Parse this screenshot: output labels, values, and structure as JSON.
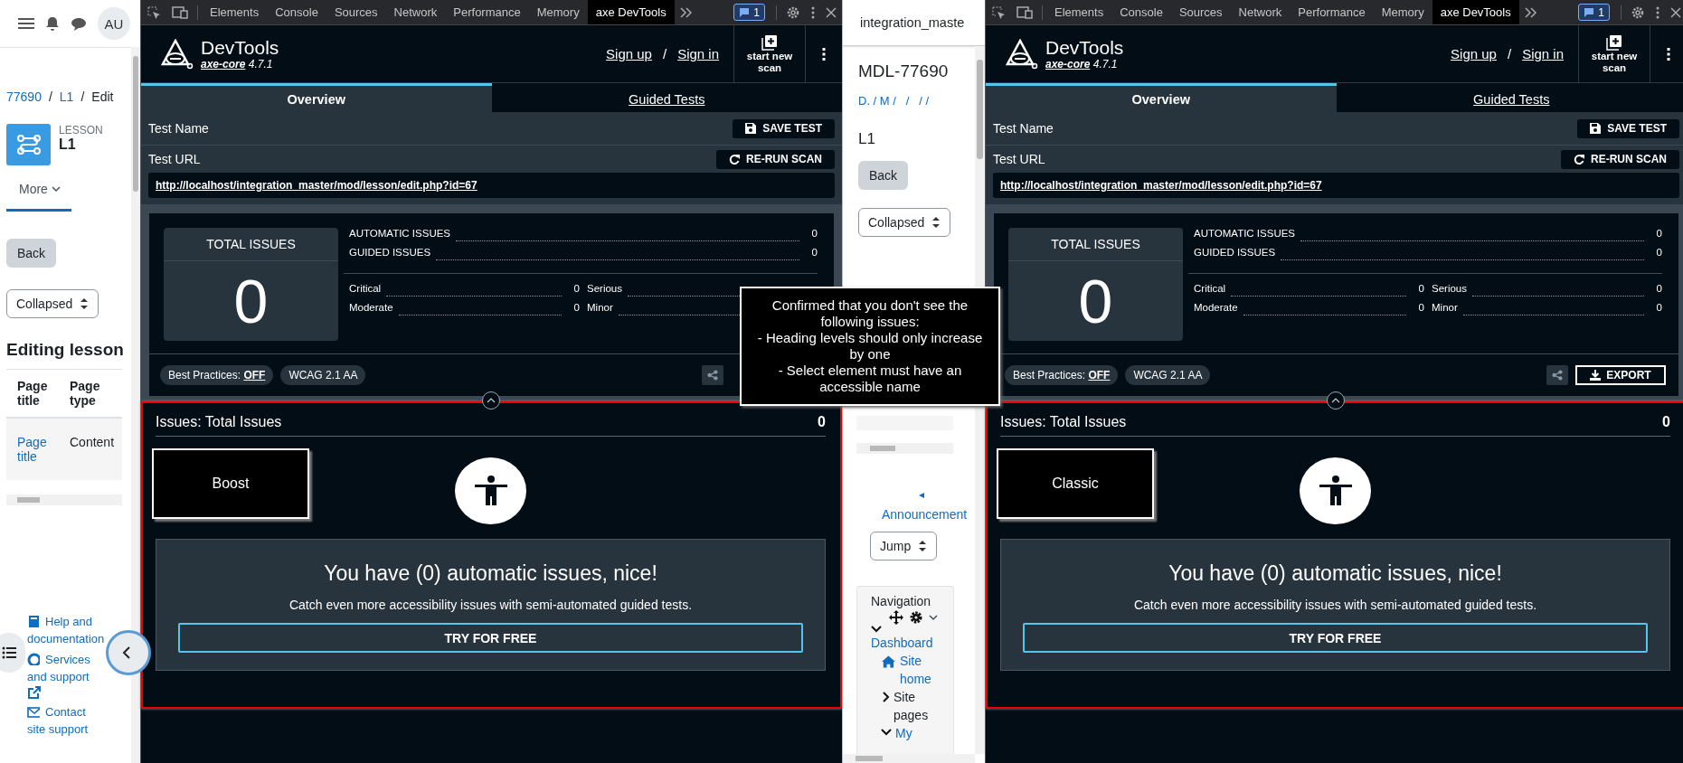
{
  "boost_page": {
    "avatar": "AU",
    "breadcrumb": [
      "77690",
      "L1",
      "Edit"
    ],
    "breadcrumb_separator": "/",
    "activity": {
      "type_label": "LESSON",
      "title": "L1"
    },
    "more": "More",
    "back_button": "Back",
    "view_select": "Collapsed",
    "heading": "Editing lesson",
    "table": {
      "columns": [
        "Page title",
        "Page type"
      ],
      "rows": [
        {
          "cells": [
            "Page title",
            "Content"
          ]
        }
      ]
    },
    "footer_links": [
      {
        "kind": "help",
        "label": "Help and documentation"
      },
      {
        "kind": "services",
        "label": "Services and support"
      },
      {
        "kind": "contact",
        "label": "Contact site support"
      }
    ]
  },
  "devtools_panes": [
    {
      "toolbar_tabs": [
        {
          "label": "Elements",
          "selected": false
        },
        {
          "label": "Console",
          "selected": false
        },
        {
          "label": "Sources",
          "selected": false
        },
        {
          "label": "Network",
          "selected": false
        },
        {
          "label": "Performance",
          "selected": false
        },
        {
          "label": "Memory",
          "selected": false
        },
        {
          "label": "axe DevTools",
          "selected": true
        }
      ],
      "message_count": "1",
      "brand": {
        "title": "DevTools",
        "engine": "axe-core",
        "version": "4.7.1"
      },
      "auth_links": [
        "Sign up",
        "Sign in"
      ],
      "auth_separator": "/",
      "new_scan": "start new scan",
      "view_tabs": [
        {
          "label": "Overview",
          "selected": true
        },
        {
          "label": "Guided Tests",
          "selected": false
        }
      ],
      "test_name_label": "Test Name",
      "save_button": "SAVE TEST",
      "test_url_label": "Test URL",
      "rerun_button": "RE-RUN SCAN",
      "url": "http://localhost/integration_master/mod/lesson/edit.php?id=67",
      "total": {
        "label": "TOTAL ISSUES",
        "value": "0"
      },
      "issue_counts": [
        {
          "label": "AUTOMATIC ISSUES",
          "value": "0"
        },
        {
          "label": "GUIDED ISSUES",
          "value": "0"
        }
      ],
      "severities": [
        {
          "label": "Critical",
          "value": "0"
        },
        {
          "label": "Serious"
        },
        {
          "label": "Moderate",
          "value": "0"
        },
        {
          "label": "Minor"
        }
      ],
      "best_practices": {
        "label": "Best Practices:",
        "value": "OFF"
      },
      "standard": "WCAG 2.1 AA",
      "issues": {
        "title": "Issues: Total Issues",
        "count": "0"
      },
      "theme_label": "Boost",
      "empty_state": {
        "heading": "You have (0) automatic issues, nice!",
        "text": "Catch even more accessibility issues with semi-automated guided tests.",
        "button": "TRY FOR FREE"
      }
    },
    {
      "toolbar_tabs": [
        {
          "label": "Elements",
          "selected": false
        },
        {
          "label": "Console",
          "selected": false
        },
        {
          "label": "Sources",
          "selected": false
        },
        {
          "label": "Network",
          "selected": false
        },
        {
          "label": "Performance",
          "selected": false
        },
        {
          "label": "Memory",
          "selected": false
        },
        {
          "label": "axe DevTools",
          "selected": true
        }
      ],
      "message_count": "1",
      "brand": {
        "title": "DevTools",
        "engine": "axe-core",
        "version": "4.7.1"
      },
      "auth_links": [
        "Sign up",
        "Sign in"
      ],
      "auth_separator": "/",
      "new_scan": "start new scan",
      "view_tabs": [
        {
          "label": "Overview",
          "selected": true
        },
        {
          "label": "Guided Tests",
          "selected": false
        }
      ],
      "test_name_label": "Test Name",
      "save_button": "SAVE TEST",
      "test_url_label": "Test URL",
      "rerun_button": "RE-RUN SCAN",
      "url": "http://localhost/integration_master/mod/lesson/edit.php?id=67",
      "total": {
        "label": "TOTAL ISSUES",
        "value": "0"
      },
      "issue_counts": [
        {
          "label": "AUTOMATIC ISSUES",
          "value": "0"
        },
        {
          "label": "GUIDED ISSUES",
          "value": "0"
        }
      ],
      "severities": [
        {
          "label": "Critical",
          "value": "0"
        },
        {
          "label": "Serious",
          "value": "0"
        },
        {
          "label": "Moderate",
          "value": "0"
        },
        {
          "label": "Minor",
          "value": "0"
        }
      ],
      "best_practices": {
        "label": "Best Practices:",
        "value": "OFF"
      },
      "standard": "WCAG 2.1 AA",
      "export_button": "EXPORT",
      "issues": {
        "title": "Issues: Total Issues",
        "count": "0"
      },
      "theme_label": "Classic",
      "empty_state": {
        "heading": "You have (0) automatic issues, nice!",
        "text": "Catch even more accessibility issues with semi-automated guided tests.",
        "button": "TRY FOR FREE"
      }
    }
  ],
  "classic_page": {
    "tab_title": "integration_maste",
    "course": "MDL-77690",
    "breadcrumb": "D. / M /   /   / /",
    "title": "L1",
    "back_button": "Back",
    "view_select": "Collapsed",
    "prev_link": "◂",
    "announcement": "Announcement",
    "jump_select": "Jump",
    "navigation": {
      "title": "Navigation",
      "items": [
        {
          "label": "Dashboard",
          "kind": "link",
          "children": [
            {
              "label": "Site home",
              "kind": "home"
            },
            {
              "label": "Site pages",
              "kind": "collapsed"
            },
            {
              "label": "My",
              "kind": "expanded"
            }
          ]
        }
      ]
    }
  },
  "tooltip": {
    "lines": [
      "Confirmed that you don't see the following issues:",
      "- Heading levels should only increase by one",
      "- Select element must have an accessible name"
    ]
  }
}
